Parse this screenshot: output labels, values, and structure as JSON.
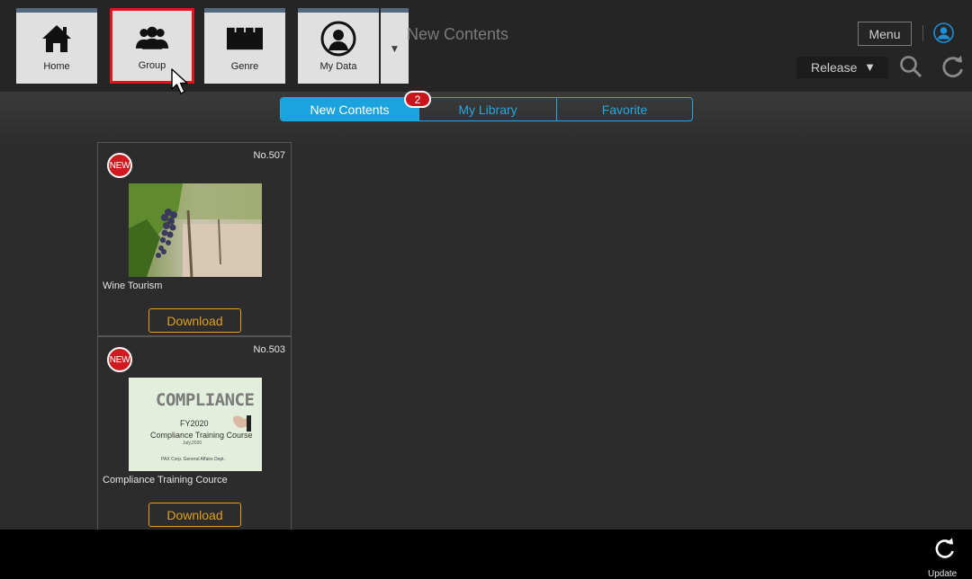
{
  "header": {
    "title": "New Contents",
    "menu_label": "Menu",
    "release_select": {
      "value": "Release"
    }
  },
  "toolbar": {
    "tiles": [
      {
        "label": "Home",
        "icon": "home-icon"
      },
      {
        "label": "Group",
        "icon": "group-icon",
        "active": true
      },
      {
        "label": "Genre",
        "icon": "genre-icon"
      },
      {
        "label": "My Data",
        "icon": "my-data-icon"
      }
    ],
    "more_icon": "dropdown-arrow-icon"
  },
  "tabs": [
    {
      "label": "New Contents",
      "selected": true
    },
    {
      "label": "My Library"
    },
    {
      "label": "Favorite"
    }
  ],
  "tab_badge": "2",
  "cards": [
    {
      "badge": "NEW",
      "number": "No.507",
      "title": "Wine Tourism",
      "thumbnail": "vineyard-grapes-image",
      "action": "Download"
    },
    {
      "badge": "NEW",
      "number": "No.503",
      "title": "Compliance Training Cource",
      "thumbnail": "compliance-course-image",
      "action": "Download",
      "thumb_text": {
        "heading": "COMPLIANCE",
        "year": "FY2020",
        "course": "Compliance Training Course",
        "date": "July,2020",
        "footer": "PAX Corp. General Affairs Dept."
      }
    }
  ],
  "bottom": {
    "update_label": "Update"
  },
  "colors": {
    "accent": "#1ba3e0",
    "badge_red": "#d01a20",
    "download": "#e0a020",
    "active_border": "#e1141c"
  }
}
